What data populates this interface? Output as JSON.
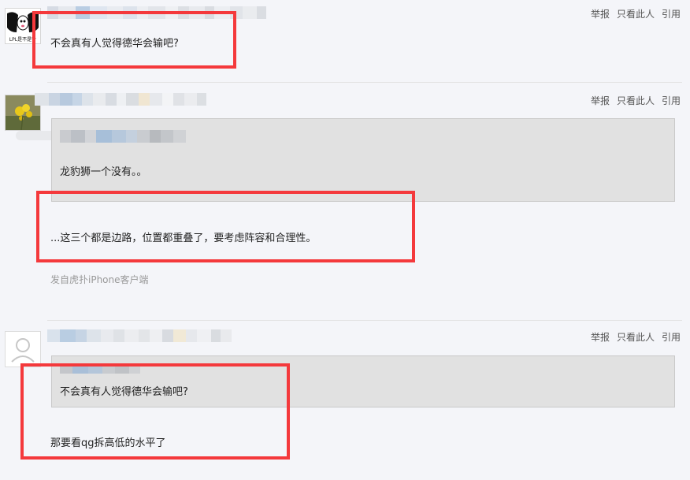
{
  "colors": {
    "highlight_box": "#f4393c",
    "page_bg": "#f4f5f9",
    "quote_bg": "#e1e1e1"
  },
  "actions": {
    "report": "举报",
    "only_this_user": "只看此人",
    "quote": "引用"
  },
  "posts": [
    {
      "avatar": {
        "icon": "panda-logo-icon",
        "caption": "LPL是不是针"
      },
      "body": "不会真有人觉得德华会输吧?"
    },
    {
      "avatar": {
        "icon": "yellow-flower-icon"
      },
      "quote_body": "龙豹狮一个没有。。",
      "body": "...这三个都是边路，位置都重叠了，要考虑阵容和合理性。",
      "client": "发自虎扑iPhone客户端"
    },
    {
      "avatar": {
        "icon": "default-user-icon"
      },
      "quote_body": "不会真有人觉得德华会输吧?",
      "body": "那要看qg拆高低的水平了"
    }
  ]
}
